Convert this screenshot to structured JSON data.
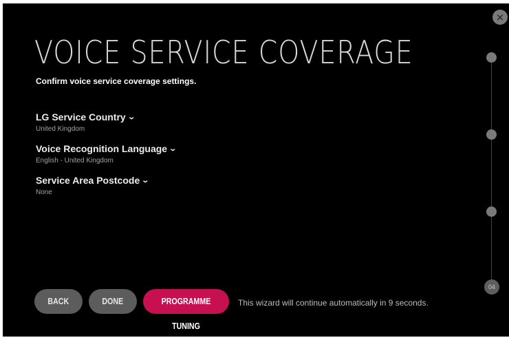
{
  "window": {
    "close_icon": "×"
  },
  "page": {
    "title": "VOICE SERVICE COVERAGE",
    "subtitle": "Confirm voice service coverage settings."
  },
  "settings": [
    {
      "label": "LG Service Country",
      "value": "United Kingdom"
    },
    {
      "label": "Voice Recognition Language",
      "value": "English - United Kingdom"
    },
    {
      "label": "Service Area Postcode",
      "value": "None"
    }
  ],
  "chevron_icon": "⌄",
  "buttons": {
    "back": "BACK",
    "done": "DONE",
    "programme_tuning": "PROGRAMME TUNING"
  },
  "notice": "This wizard will continue automatically in 9 seconds.",
  "progress": {
    "current_step_label": "04"
  },
  "colors": {
    "accent": "#c6104f",
    "background": "#000000",
    "button_secondary": "#5c5c5c"
  }
}
